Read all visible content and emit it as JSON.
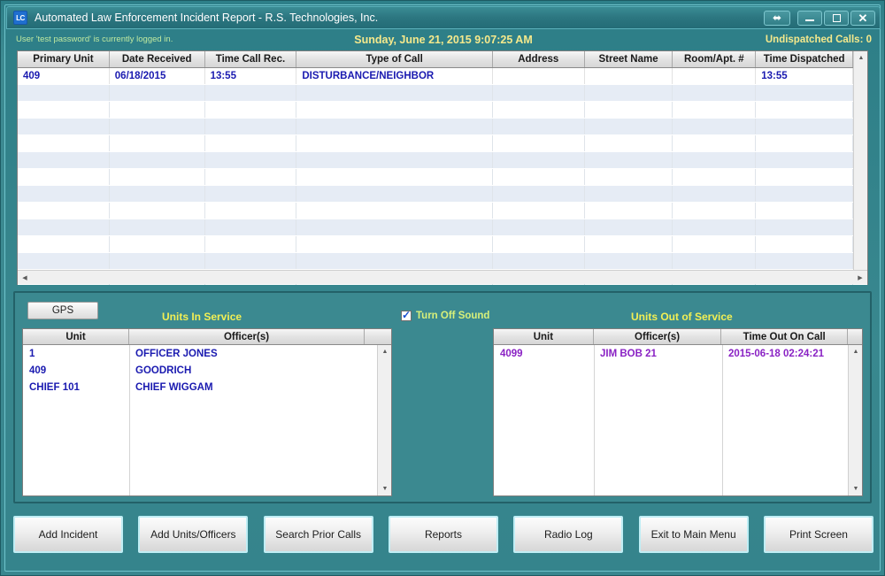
{
  "window": {
    "icon_label": "LC",
    "title": "Automated Law Enforcement Incident Report - R.S. Technologies, Inc.",
    "controls": {
      "resize": "⬌",
      "minimize": "minimize",
      "maximize": "maximize",
      "close": "✕"
    }
  },
  "status": {
    "left": "User 'test password' is currently logged in.",
    "center": "Sunday, June 21, 2015   9:07:25 AM",
    "right": "Undispatched Calls: 0"
  },
  "calls_grid": {
    "columns": [
      "Primary Unit",
      "Date Received",
      "Time Call Rec.",
      "Type of Call",
      "Address",
      "Street Name",
      "Room/Apt. #",
      "Time Dispatched"
    ],
    "rows": [
      {
        "primary_unit": "409",
        "date_received": "06/18/2015",
        "time_call_rec": "13:55",
        "type_of_call": "DISTURBANCE/NEIGHBOR",
        "address": "",
        "street_name": "",
        "room_apt": "",
        "time_dispatched": "13:55"
      }
    ],
    "empty_row_count": 12
  },
  "middle": {
    "gps_button": "GPS",
    "in_service_title": "Units In Service",
    "out_service_title": "Units Out of Service",
    "sound_checkbox_label": "Turn Off Sound",
    "sound_checked": true,
    "in_service": {
      "columns": [
        "Unit",
        "Officer(s)"
      ],
      "rows": [
        {
          "unit": "1",
          "officers": "OFFICER JONES"
        },
        {
          "unit": "409",
          "officers": "GOODRICH"
        },
        {
          "unit": "CHIEF 101",
          "officers": "CHIEF WIGGAM"
        }
      ]
    },
    "out_service": {
      "columns": [
        "Unit",
        "Officer(s)",
        "Time Out On Call"
      ],
      "rows": [
        {
          "unit": "4099",
          "officers": "JIM BOB 21",
          "time_out": "2015-06-18 02:24:21"
        }
      ]
    }
  },
  "buttons": [
    {
      "label": "Add Incident"
    },
    {
      "label": "Add Units/Officers"
    },
    {
      "label": "Search Prior Calls"
    },
    {
      "label": "Reports"
    },
    {
      "label": "Radio Log"
    },
    {
      "label": "Exit to Main Menu"
    },
    {
      "label": "Print Screen"
    }
  ],
  "colors": {
    "window_teal": "#38878f",
    "accent_yellow": "#f2ef54",
    "grid_text_blue": "#1a1ab0",
    "out_service_purple": "#8a22c4",
    "status_green": "#bfe9a0"
  }
}
